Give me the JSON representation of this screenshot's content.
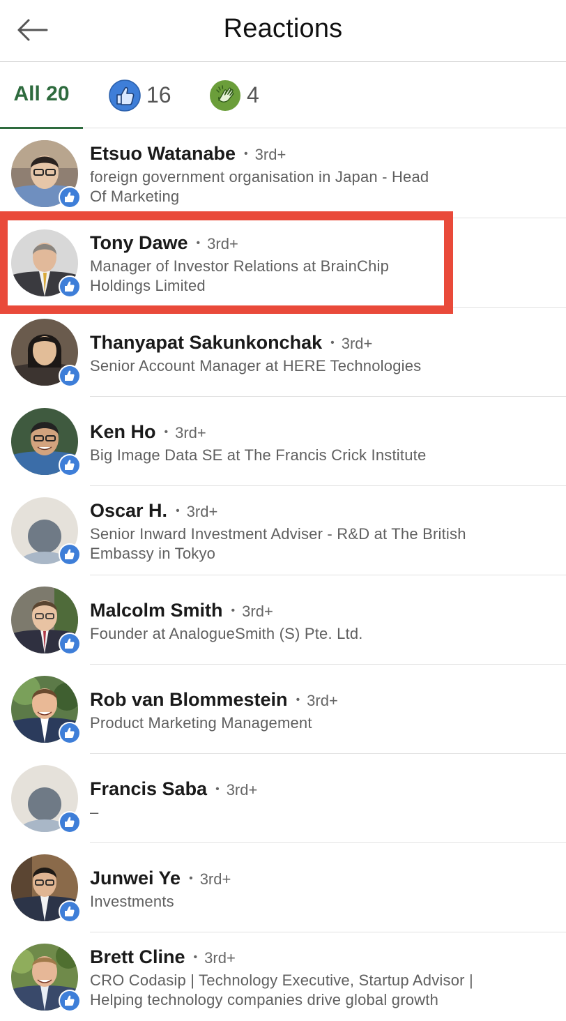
{
  "header": {
    "title": "Reactions"
  },
  "tabs": [
    {
      "label": "All 20"
    },
    {
      "icon": "like-icon",
      "count": "16"
    },
    {
      "icon": "clap-icon",
      "count": "4"
    }
  ],
  "accent": "#2e6b3e",
  "like_color": "#3e7ed8",
  "highlight_color": "#e94a3a",
  "reactions": [
    {
      "name": "Etsuo Watanabe",
      "degree": "3rd+",
      "headline": [
        "foreign government organisation in Japan - Head",
        "Of Marketing"
      ]
    },
    {
      "name": "Tony Dawe",
      "degree": "3rd+",
      "headline": [
        "Manager of Investor Relations at BrainChip",
        "Holdings Limited"
      ]
    },
    {
      "name": "Thanyapat Sakunkonchak",
      "degree": "3rd+",
      "headline": [
        "Senior Account Manager at HERE Technologies"
      ]
    },
    {
      "name": "Ken Ho",
      "degree": "3rd+",
      "headline": [
        "Big Image Data SE at The Francis Crick Institute"
      ]
    },
    {
      "name": "Oscar H.",
      "degree": "3rd+",
      "headline": [
        "Senior Inward Investment Adviser - R&D at The British",
        "Embassy in Tokyo"
      ]
    },
    {
      "name": "Malcolm Smith",
      "degree": "3rd+",
      "headline": [
        "Founder at AnalogueSmith (S) Pte. Ltd."
      ]
    },
    {
      "name": "Rob van Blommestein",
      "degree": "3rd+",
      "headline": [
        "Product Marketing Management"
      ]
    },
    {
      "name": "Francis Saba",
      "degree": "3rd+",
      "headline": [
        "–"
      ]
    },
    {
      "name": "Junwei Ye",
      "degree": "3rd+",
      "headline": [
        "Investments"
      ]
    },
    {
      "name": "Brett Cline",
      "degree": "3rd+",
      "headline": [
        "CRO Codasip | Technology Executive, Startup Advisor |",
        "Helping technology companies drive global growth"
      ]
    }
  ]
}
